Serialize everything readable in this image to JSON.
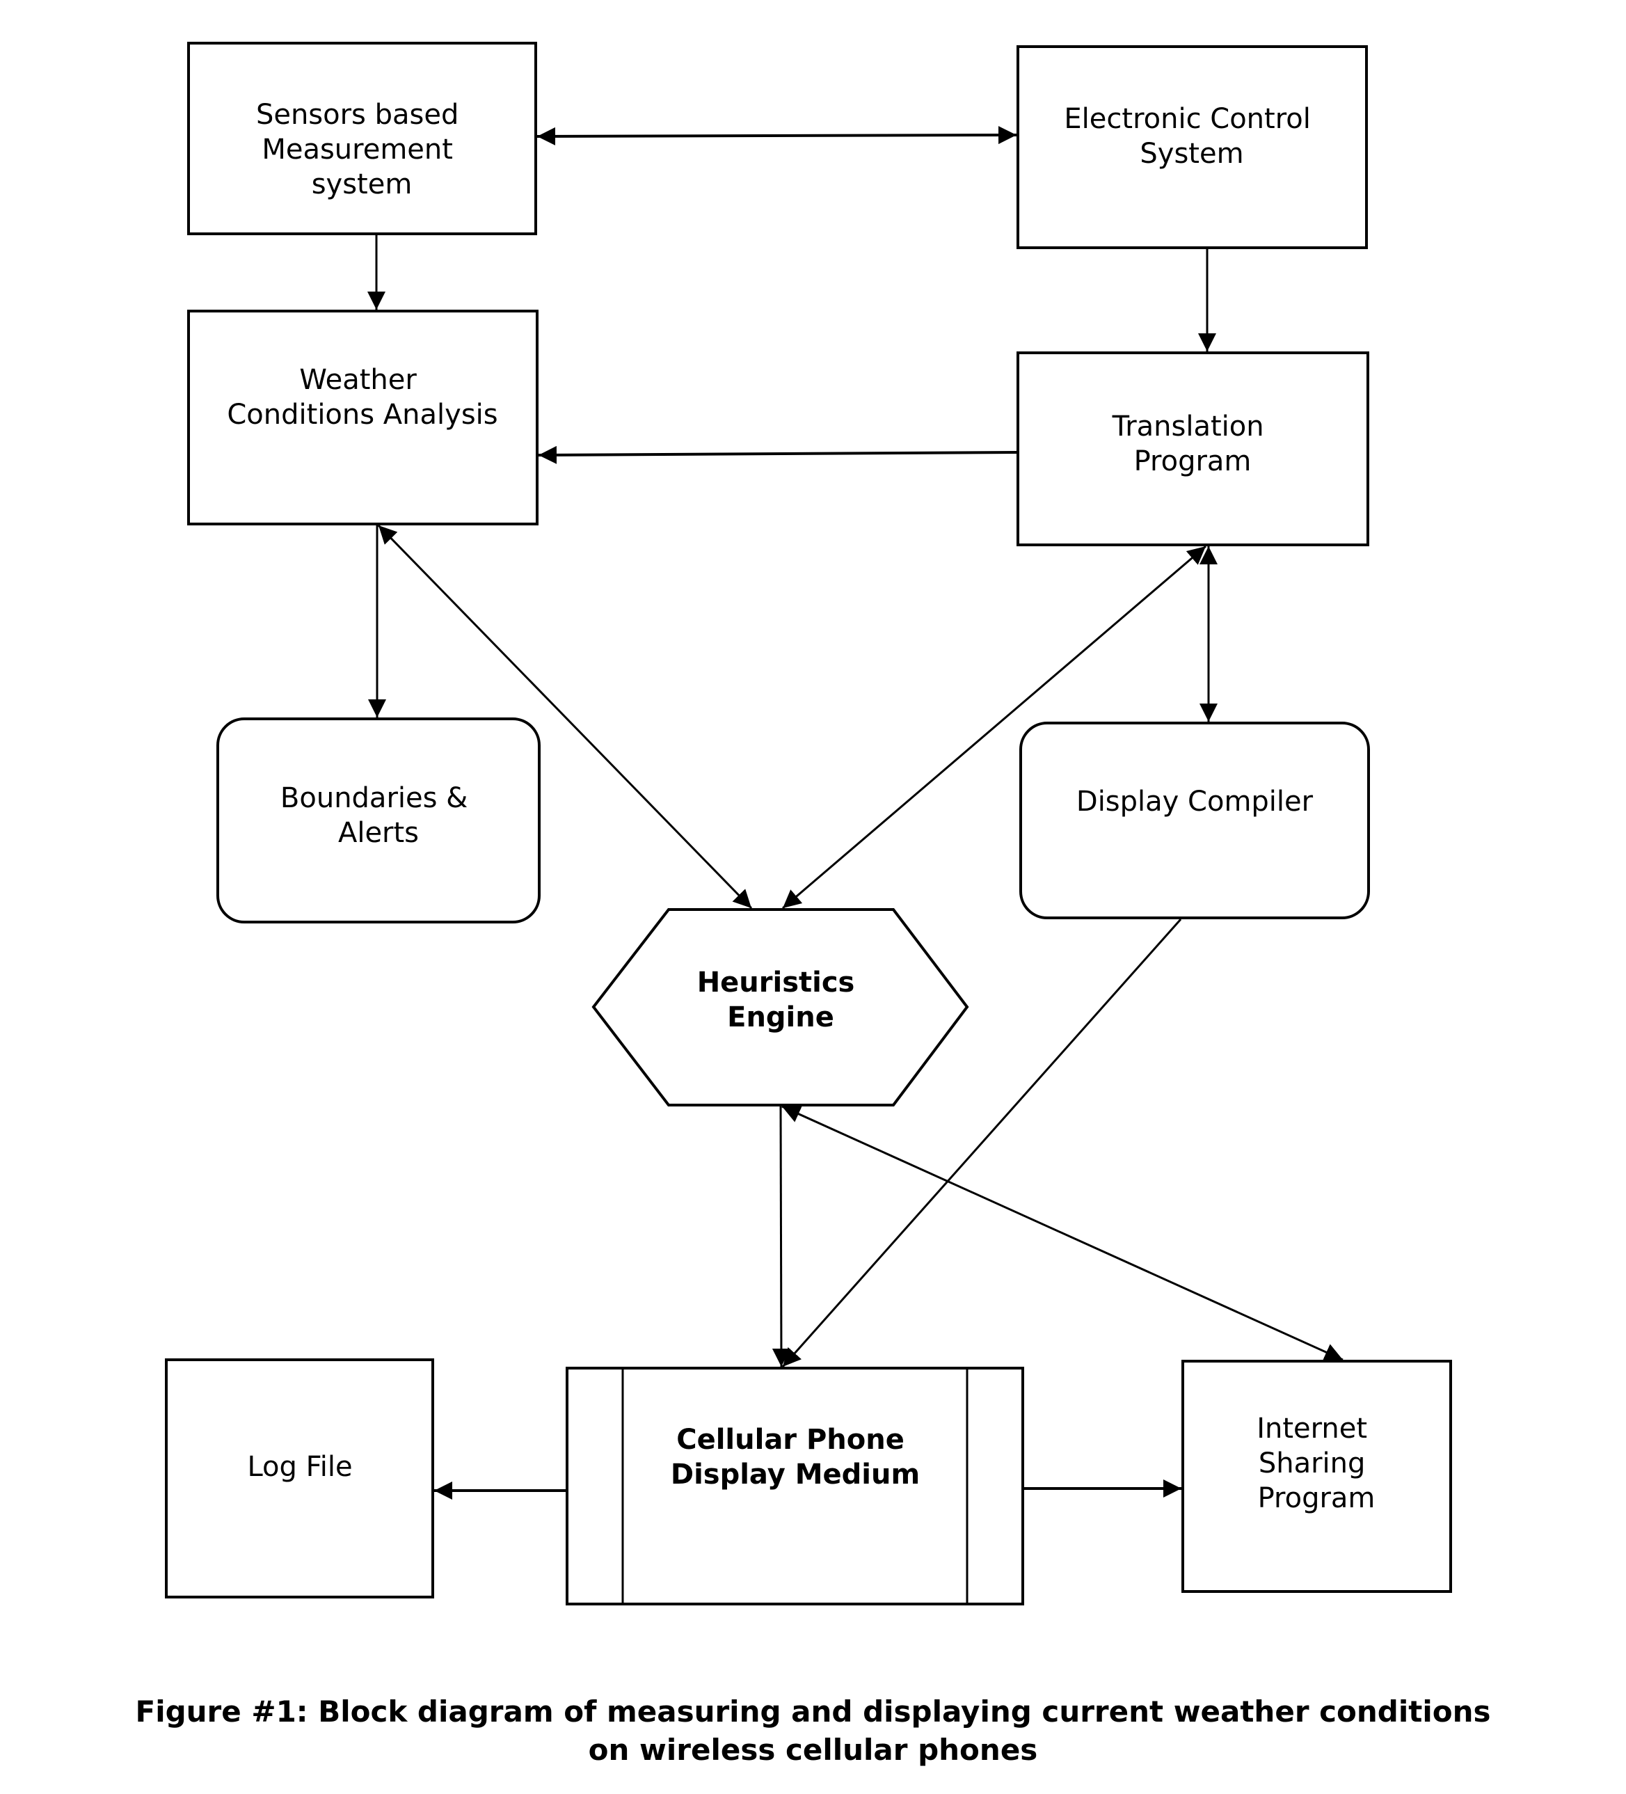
{
  "nodes": {
    "sensors": {
      "lines": [
        "Sensors based",
        "Measurement",
        "system"
      ],
      "shape": "rectangle"
    },
    "electronic_control": {
      "lines": [
        "Electronic Control",
        "System"
      ],
      "shape": "rectangle"
    },
    "weather_analysis": {
      "lines": [
        "Weather",
        "Conditions Analysis"
      ],
      "shape": "rectangle"
    },
    "translation": {
      "lines": [
        "Translation",
        "Program"
      ],
      "shape": "rectangle"
    },
    "boundaries": {
      "lines": [
        "Boundaries &",
        "Alerts"
      ],
      "shape": "rounded-rectangle"
    },
    "display_compiler": {
      "lines": [
        "Display Compiler"
      ],
      "shape": "rounded-rectangle"
    },
    "heuristics": {
      "lines": [
        "Heuristics",
        "Engine"
      ],
      "shape": "hexagon"
    },
    "log_file": {
      "lines": [
        "Log File"
      ],
      "shape": "rectangle"
    },
    "cellular": {
      "lines": [
        "Cellular Phone",
        "Display Medium"
      ],
      "shape": "predefined-process"
    },
    "internet_sharing": {
      "lines": [
        "Internet",
        "Sharing",
        "Program"
      ],
      "shape": "rectangle"
    }
  },
  "edges": [
    {
      "from": "sensors",
      "to": "electronic_control",
      "direction": "both"
    },
    {
      "from": "sensors",
      "to": "weather_analysis",
      "direction": "forward"
    },
    {
      "from": "electronic_control",
      "to": "translation",
      "direction": "forward"
    },
    {
      "from": "translation",
      "to": "weather_analysis",
      "direction": "forward"
    },
    {
      "from": "weather_analysis",
      "to": "boundaries",
      "direction": "forward"
    },
    {
      "from": "weather_analysis",
      "to": "heuristics",
      "direction": "both"
    },
    {
      "from": "translation",
      "to": "heuristics",
      "direction": "both"
    },
    {
      "from": "translation",
      "to": "display_compiler",
      "direction": "both"
    },
    {
      "from": "display_compiler",
      "to": "cellular",
      "direction": "forward"
    },
    {
      "from": "heuristics",
      "to": "cellular",
      "direction": "forward"
    },
    {
      "from": "heuristics",
      "to": "internet_sharing",
      "direction": "both"
    },
    {
      "from": "cellular",
      "to": "log_file",
      "direction": "forward"
    },
    {
      "from": "cellular",
      "to": "internet_sharing",
      "direction": "forward"
    }
  ],
  "caption": {
    "line1": "Figure #1: Block diagram of measuring and displaying current weather conditions",
    "line2": "on wireless cellular phones"
  }
}
